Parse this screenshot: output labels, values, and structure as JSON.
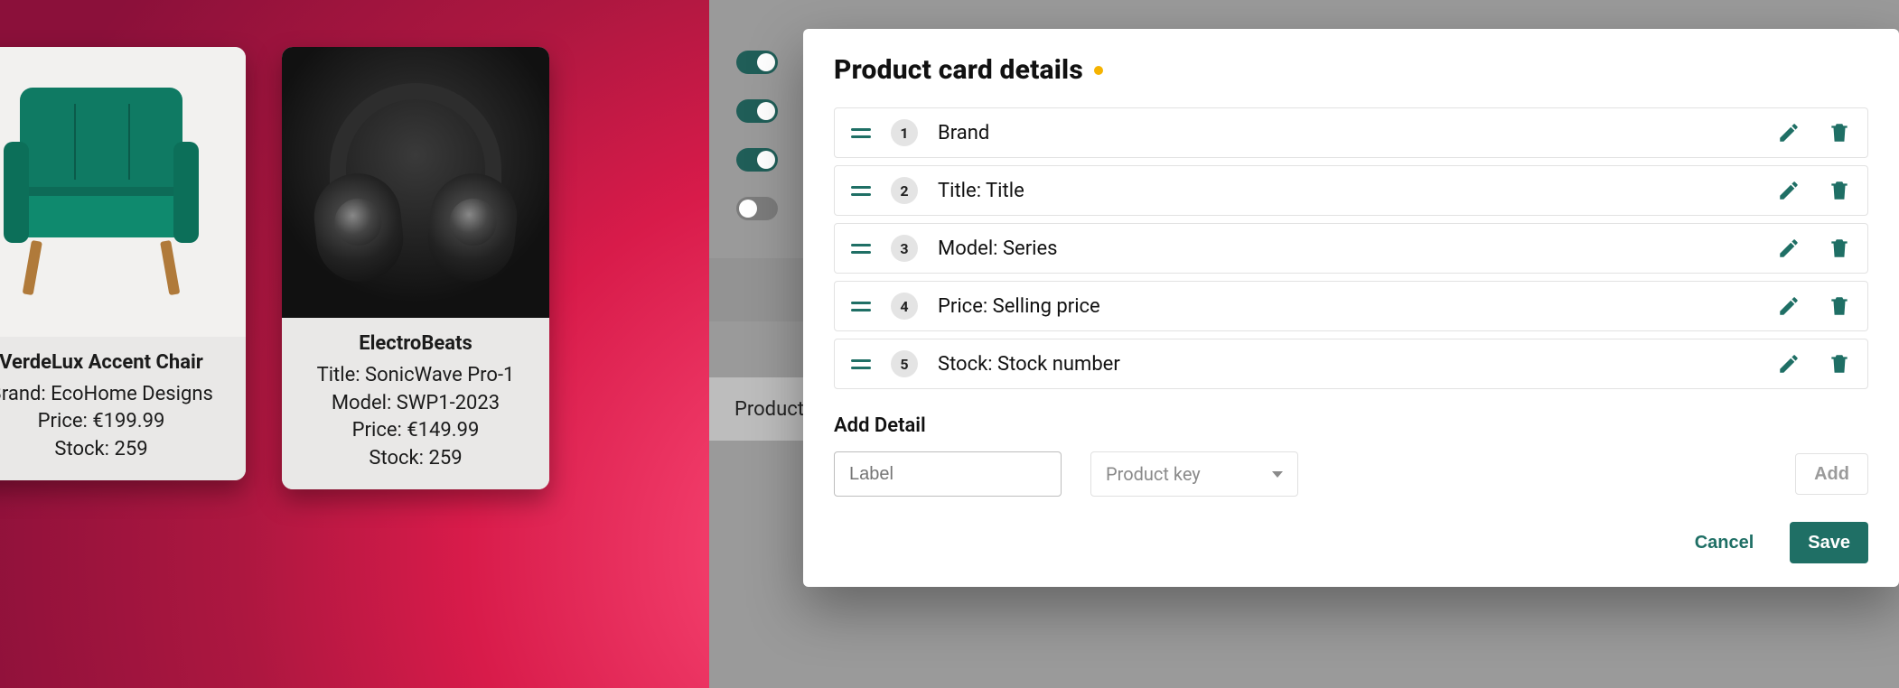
{
  "colors": {
    "accent": "#1f6f65",
    "warn_dot": "#f5b301"
  },
  "preview": {
    "cards": [
      {
        "title": "VerdeLux Accent Chair",
        "lines": [
          "Brand: EcoHome Designs",
          "Price: €199.99",
          "Stock: 259"
        ]
      },
      {
        "title": "ElectroBeats",
        "lines": [
          "Title: SonicWave Pro-1",
          "Model: SWP1-2023",
          "Price: €149.99",
          "Stock: 259"
        ]
      }
    ]
  },
  "background": {
    "toggles": [
      true,
      true,
      true,
      false
    ],
    "row_label": "Product k"
  },
  "modal": {
    "title": "Product card details",
    "items": [
      {
        "n": "1",
        "label": "Brand"
      },
      {
        "n": "2",
        "label": "Title: Title"
      },
      {
        "n": "3",
        "label": "Model: Series"
      },
      {
        "n": "4",
        "label": "Price: Selling price"
      },
      {
        "n": "5",
        "label": "Stock: Stock number"
      }
    ],
    "add": {
      "heading": "Add Detail",
      "label_placeholder": "Label",
      "select_placeholder": "Product key",
      "add_button": "Add"
    },
    "footer": {
      "cancel": "Cancel",
      "save": "Save"
    }
  }
}
